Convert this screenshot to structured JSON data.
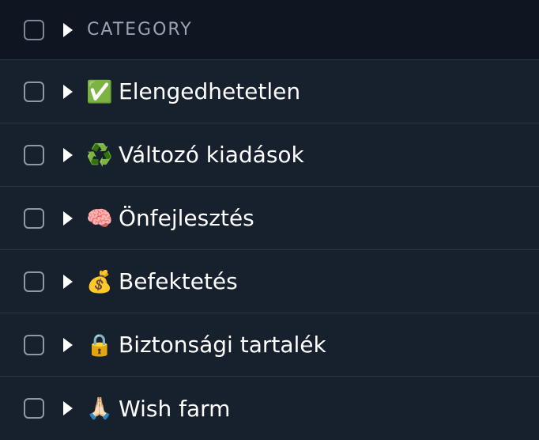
{
  "header": {
    "label": "CATEGORY"
  },
  "rows": [
    {
      "icon": "✅",
      "icon_name": "check-mark-button-icon",
      "label": "Elengedhetetlen"
    },
    {
      "icon": "♻️",
      "icon_name": "recycling-icon",
      "label": "Változó kiadások"
    },
    {
      "icon": "🧠",
      "icon_name": "brain-icon",
      "label": "Önfejlesztés"
    },
    {
      "icon": "💰",
      "icon_name": "money-bag-icon",
      "label": "Befektetés"
    },
    {
      "icon": "🔒",
      "icon_name": "lock-icon",
      "label": "Biztonsági tartalék"
    },
    {
      "icon": "🙏🏻",
      "icon_name": "folded-hands-icon",
      "label": "Wish farm"
    }
  ]
}
